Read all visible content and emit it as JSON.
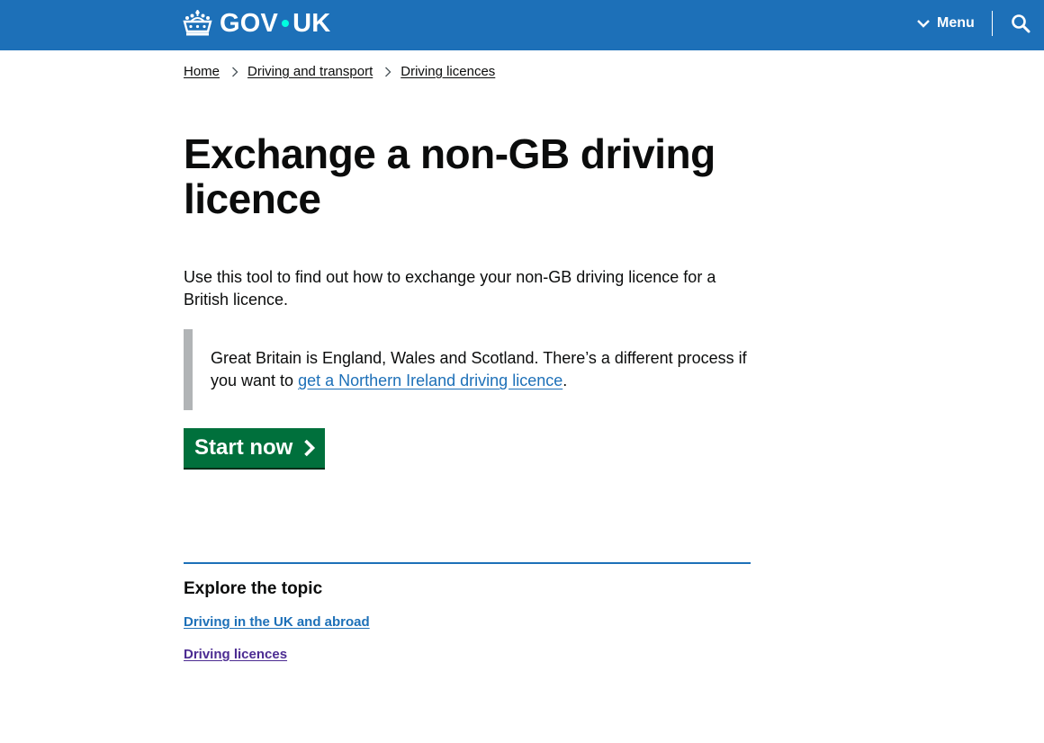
{
  "header": {
    "logo_text_left": "GOV",
    "logo_text_right": "UK",
    "menu_label": "Menu",
    "background_color": "#1d70b8",
    "icons": {
      "crown": "crown-logo-icon",
      "menu": "chevron-down-icon",
      "search": "search-icon"
    }
  },
  "breadcrumbs": [
    {
      "label": "Home"
    },
    {
      "label": "Driving and transport"
    },
    {
      "label": "Driving licences"
    }
  ],
  "main": {
    "title": "Exchange a non-GB driving licence",
    "lede": "Use this tool to find out how to exchange your non-GB driving licence for a British licence.",
    "inset": {
      "text_before": "Great Britain is England, Wales and Scotland. There’s a different process if you want to ",
      "link_text": "get a Northern Ireland driving licence",
      "text_after": "."
    },
    "start_button_label": "Start now",
    "start_button_color": "#00703c"
  },
  "topic": {
    "heading": "Explore the topic",
    "links": [
      {
        "label": "Driving in the UK and abroad",
        "color": "#1d70b8"
      },
      {
        "label": "Driving licences",
        "color": "#4c2c92"
      }
    ]
  }
}
